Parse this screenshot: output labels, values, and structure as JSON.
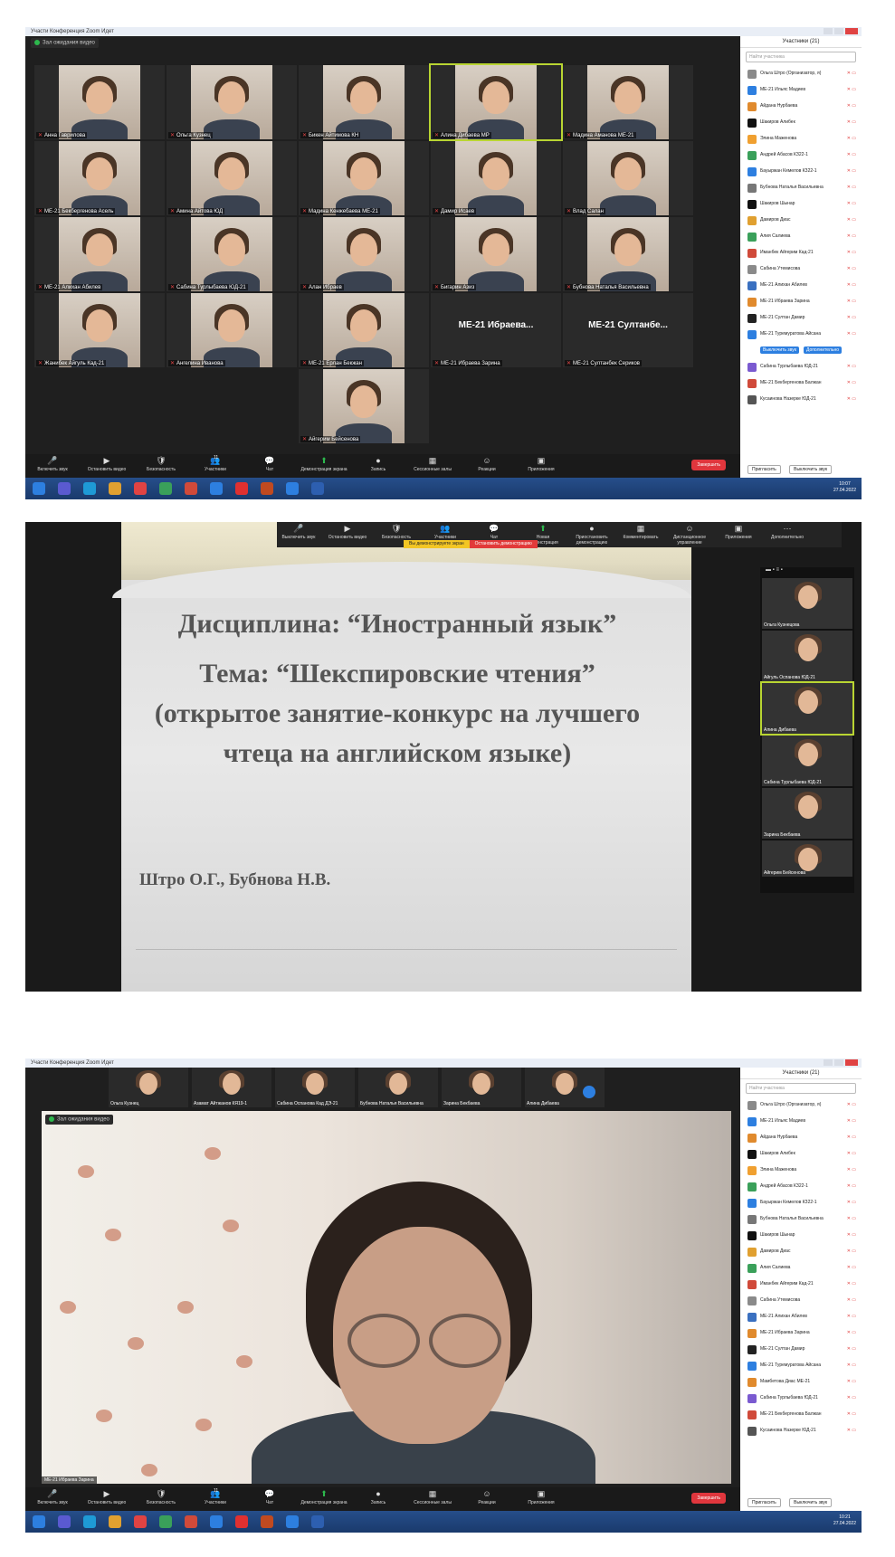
{
  "screen1": {
    "window_title": "Участи Конференция Zoom Идет",
    "view_label": "Зал ожидания видео",
    "tiles": [
      {
        "name": "Анна Гаврилова",
        "big": ""
      },
      {
        "name": "Ольга Кузнец",
        "big": ""
      },
      {
        "name": "Бикен Айтимова КН",
        "big": ""
      },
      {
        "name": "Алина Дибаева МР",
        "big": "",
        "active": true
      },
      {
        "name": "Мадина Аманова МЕ-21",
        "big": ""
      },
      {
        "name": "МЕ-21 Бекбергенова Асель",
        "big": ""
      },
      {
        "name": "Амина Айтова ЮД",
        "big": ""
      },
      {
        "name": "Мадина Кенжебаева МЕ-21",
        "big": ""
      },
      {
        "name": "Дамир Исаев",
        "big": ""
      },
      {
        "name": "Влад Салан",
        "big": ""
      },
      {
        "name": "МЕ-21 Алихан Абилев",
        "big": ""
      },
      {
        "name": "Сабина Турлыбаева ЮД-21",
        "big": ""
      },
      {
        "name": "Алан Ибраев",
        "big": ""
      },
      {
        "name": "Бигарин Азиз",
        "big": ""
      },
      {
        "name": "Бубнова Наталья Васильевна",
        "big": ""
      },
      {
        "name": "Жанибек Айгуль Кад-21",
        "big": ""
      },
      {
        "name": "Ангелина Иванова",
        "big": ""
      },
      {
        "name": "МЕ-21 Ерлан Бекжан",
        "big": ""
      },
      {
        "name": "МЕ-21 Ибраева Зарина",
        "big": "ME-21 Ибраева..."
      },
      {
        "name": "МЕ-21 Султанбек Сериков",
        "big": "ME-21 Султанбе..."
      },
      {
        "name": "Айгерим Бейсенова",
        "big": ""
      }
    ],
    "toolbar": [
      "Включить звук",
      "Остановить видео",
      "Безопасность",
      "Участники",
      "Чат",
      "Демонстрация экрана",
      "Запись",
      "Сессионные залы",
      "Реакции",
      "Приложения"
    ],
    "participants_count": "11",
    "end_label": "Завершить",
    "panel_title": "Участники (21)",
    "search_placeholder": "Найти участника",
    "participants": [
      "Ольга Штро (Организатор, я)",
      "МЕ-21 Ильяс Мадиев",
      "Айдана Нурбаева",
      "Шакиров Алибек",
      "Элина Маженова",
      "Андрей Абасов КЗ22-1",
      "Бауыржан Кемелов КЗ22-1",
      "Бубнова Наталья Васильевна",
      "Шакиров Шынар",
      "Дамиров Диас",
      "Алия Салиева",
      "Иманбек Айгерим Кад-21",
      "Сабина Утемисова",
      "МЕ-21 Алихан Абилев",
      "МЕ-21 Ибраева Зарина",
      "МЕ-21 Султан Дамир",
      "МЕ-21 Туремуратова Айсана"
    ],
    "mute_all": "Выключить звук",
    "more": "Дополнительно",
    "participants_after": [
      "Сабина Турлыбаева ЮД-21",
      "МЕ-21 Бекбергенова Балжан",
      "Кусаинова Назерке ЮД-21"
    ],
    "panel_footer": [
      "Пригласить",
      "Выключить звук"
    ],
    "clock": {
      "time": "10:07",
      "date": "27.04.2022"
    }
  },
  "screen2": {
    "toolbar": [
      "Выключить звук",
      "Остановить видео",
      "Безопасность",
      "Участники",
      "Чат",
      "Новая демонстрация",
      "Приостановить демонстрацию",
      "Комментировать",
      "Дистанционное управление",
      "Приложения",
      "Дополнительно"
    ],
    "notice_yellow": "Вы демонстрируете экран",
    "notice_red": "Остановить демонстрацию",
    "slide_line1": "Дисциплина: “Иностранный язык”",
    "slide_line2": "Тема: “Шекспировские чтения” (открытое занятие-конкурс на лучшего чтеца на английском языке)",
    "slide_authors": "Штро О.Г., Бубнова Н.В.",
    "side_tiles": [
      "Ольга Кузнецова",
      "Айгуль Оспанова ЮД-21",
      "Алина Дибаева",
      "Сабина Турлыбаева ЮД-21",
      "Зарина Бекбаева",
      "Айгерим Бейсенова"
    ]
  },
  "screen3": {
    "window_title": "Участи Конференция Zoom Идет",
    "strip": [
      "Ольга Кузнец",
      "Азамат Айтжанов КЯ19-1",
      "Сабина Оспанова Кад ДЭ-21",
      "Бубнова Наталья Васильевна",
      "Зарина Бекбаева",
      "Алина Дибаева"
    ],
    "view_label": "Зал ожидания видео",
    "speaker_label": "МЕ-21 Ибраева Зарина",
    "toolbar": [
      "Включить звук",
      "Остановить видео",
      "Безопасность",
      "Участники",
      "Чат",
      "Демонстрация экрана",
      "Запись",
      "Сессионные залы",
      "Реакции",
      "Приложения"
    ],
    "participants_count": "11",
    "end_label": "Завершить",
    "panel_title": "Участники (21)",
    "search_placeholder": "Найти участника",
    "participants": [
      "Ольга Штро (Организатор, я)",
      "МЕ-21 Ильяс Мадиев",
      "Айдана Нурбаева",
      "Шакиров Алибек",
      "Элина Маженова",
      "Андрей Абасов КЗ22-1",
      "Бауыржан Кемелов КЗ22-1",
      "Бубнова Наталья Васильевна",
      "Шакиров Шынар",
      "Дамиров Диас",
      "Алия Салиева",
      "Иманбек Айгерим Кад-21",
      "Сабина Утемисова",
      "МЕ-21 Алихан Абилев",
      "МЕ-21 Ибраева Зарина",
      "МЕ-21 Султан Дамир",
      "МЕ-21 Туремуратова Айсана",
      "Мамбетова Диас МЕ-21",
      "Сабина Турлыбаева ЮД-21",
      "МЕ-21 Бекбергенова Балжан",
      "Кусаинова Назерке ЮД-21"
    ],
    "panel_footer": [
      "Пригласить",
      "Выключить звук"
    ],
    "clock": {
      "time": "10:21",
      "date": "27.04.2022"
    }
  },
  "colors": {
    "zoom_dark": "#1f1f1f",
    "active_outline": "#b9d532",
    "end_red": "#e0363d",
    "zoom_blue": "#2d7fe0",
    "taskbar": "#1a3a6c"
  }
}
